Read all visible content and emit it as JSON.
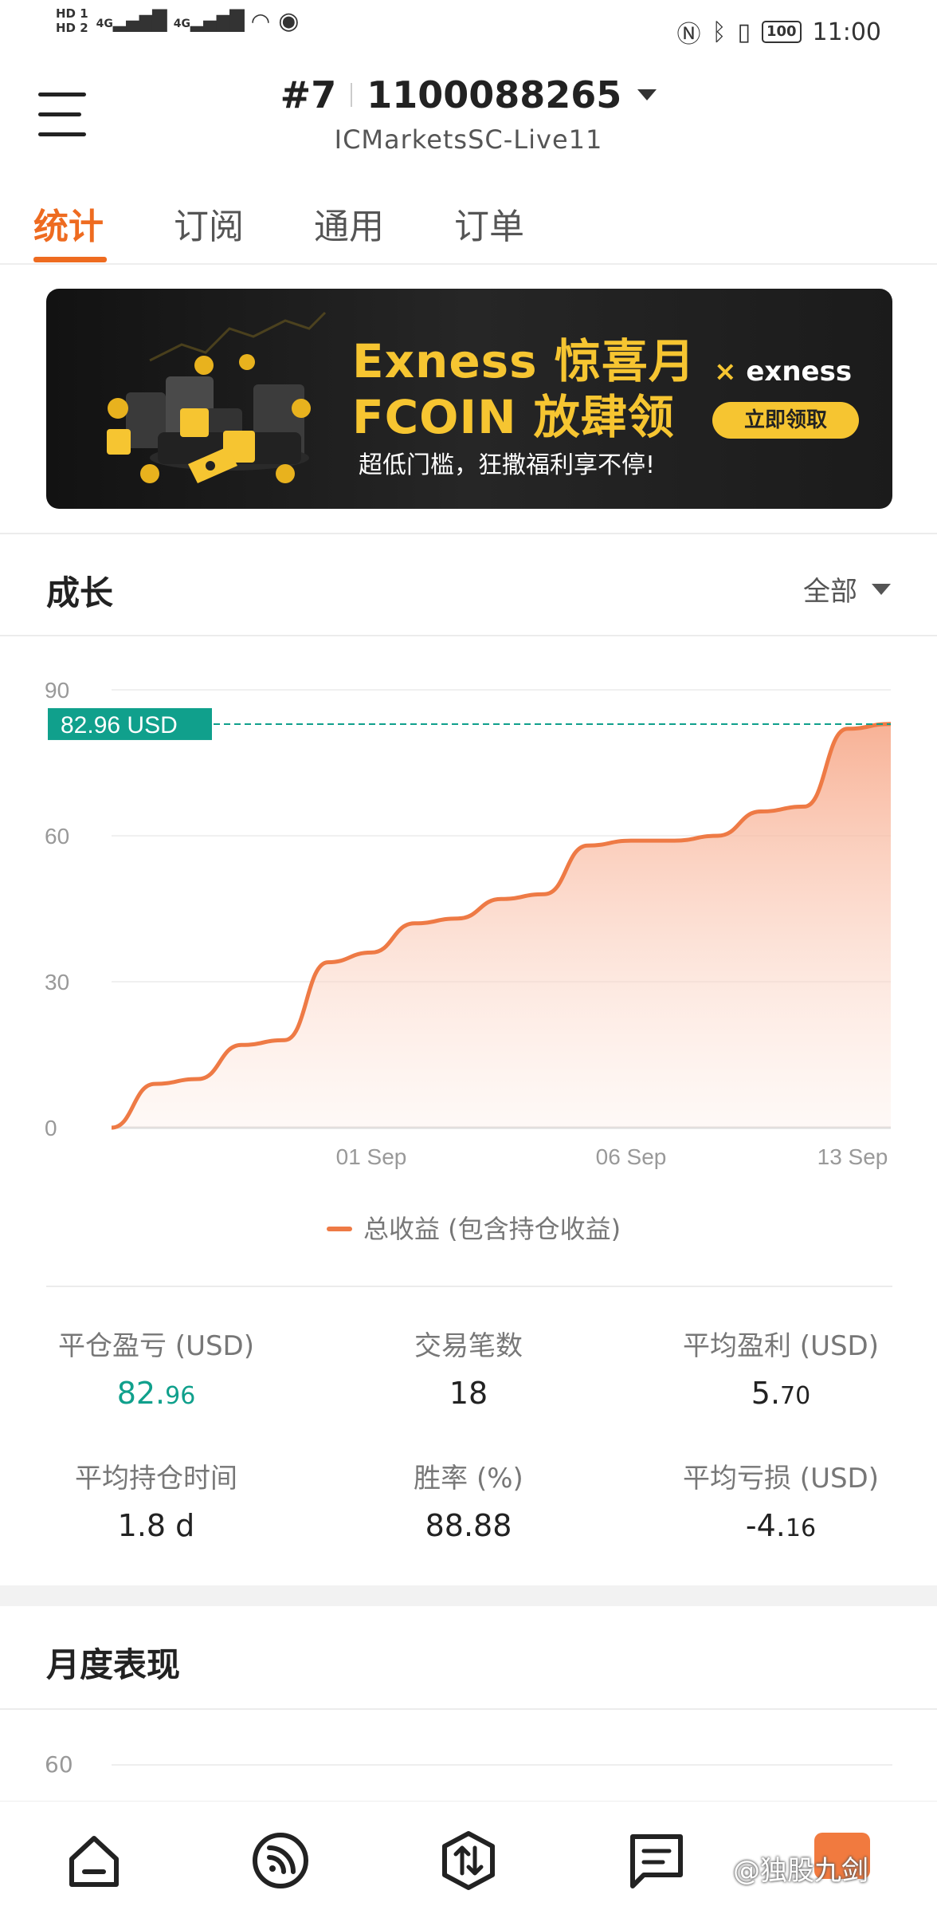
{
  "status_bar": {
    "hd1": "HD 1",
    "hd2": "HD 2",
    "net1": "4G",
    "net2": "4G",
    "battery": "100",
    "time": "11:00"
  },
  "header": {
    "account_rank": "#7",
    "account_number": "1100088265",
    "server": "ICMarketsSC-Live11"
  },
  "tabs": [
    {
      "label": "统计",
      "active": true
    },
    {
      "label": "订阅",
      "active": false
    },
    {
      "label": "通用",
      "active": false
    },
    {
      "label": "订单",
      "active": false
    }
  ],
  "banner": {
    "title_line1": "Exness 惊喜月",
    "title_line2": "FCOIN 放肆领",
    "subtitle": "超低门槛，狂撒福利享不停!",
    "brand": "exness",
    "cta": "立即领取"
  },
  "growth": {
    "title": "成长",
    "filter": "全部",
    "current_label": "82.96 USD",
    "legend": "总收益 (包含持仓收益)"
  },
  "chart_data": {
    "type": "area",
    "ylim": [
      0,
      90
    ],
    "y_ticks": [
      "0",
      "30",
      "60",
      "90"
    ],
    "x_tick_labels": [
      "01 Sep",
      "06 Sep",
      "13 Sep"
    ],
    "series": [
      {
        "name": "总收益 (包含持仓收益)",
        "values": [
          0,
          9,
          10,
          17,
          18,
          34,
          36,
          42,
          43,
          47,
          48,
          58,
          59,
          59,
          60,
          65,
          66,
          82,
          83
        ]
      }
    ],
    "current_value": 82.96,
    "colors": {
      "line": "#ee7a45",
      "fill": "#f9c2a8",
      "marker": "#10a08c"
    }
  },
  "stats": [
    {
      "label": "平仓盈亏 (USD)",
      "value_main": "82.",
      "value_small": "96",
      "color": "green"
    },
    {
      "label": "交易笔数",
      "value_main": "18",
      "value_small": ""
    },
    {
      "label": "平均盈利 (USD)",
      "value_main": "5.",
      "value_small": "70"
    },
    {
      "label": "平均持仓时间",
      "value_main": "1.8 d",
      "value_small": ""
    },
    {
      "label": "胜率 (%)",
      "value_main": "88.88",
      "value_small": ""
    },
    {
      "label": "平均亏损 (USD)",
      "value_main": "-4.",
      "value_small": "16"
    }
  ],
  "monthly": {
    "title": "月度表现",
    "first_tick": "60"
  },
  "watermark": "@独股九剑"
}
